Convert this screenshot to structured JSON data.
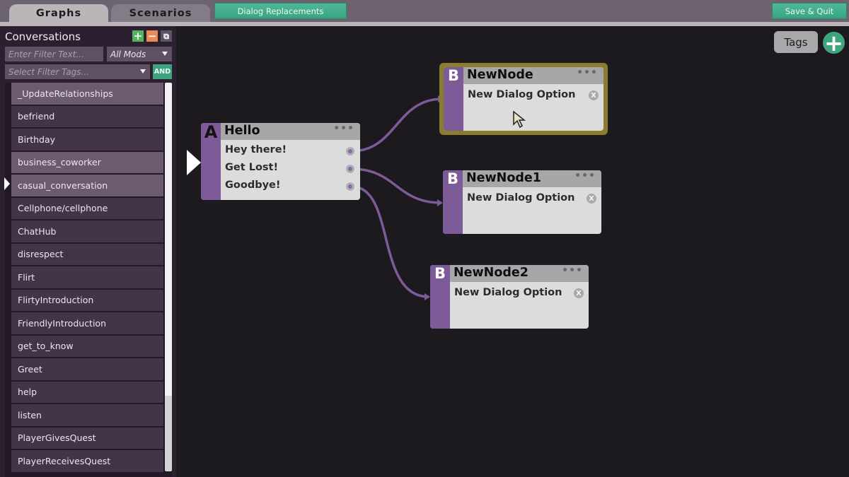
{
  "topbar": {
    "tabs": [
      {
        "label": "Graphs",
        "active": true
      },
      {
        "label": "Scenarios",
        "active": false
      }
    ],
    "dialog_replacements_label": "Dialog Replacements",
    "save_quit_label": "Save & Quit"
  },
  "sidebar": {
    "title": "Conversations",
    "add_icon": "plus-icon",
    "remove_icon": "minus-icon",
    "duplicate_icon": "copy-icon",
    "filter_text_placeholder": "Enter Filter Text...",
    "mods_select_value": "All Mods",
    "filter_tags_placeholder": "Select Filter Tags...",
    "and_label": "AND",
    "selected_index": 4,
    "items": [
      {
        "label": "_UpdateRelationships",
        "highlighted": true
      },
      {
        "label": "befriend",
        "highlighted": false
      },
      {
        "label": "Birthday",
        "highlighted": false
      },
      {
        "label": "business_coworker",
        "highlighted": true
      },
      {
        "label": "casual_conversation",
        "highlighted": true
      },
      {
        "label": "Cellphone/cellphone",
        "highlighted": false
      },
      {
        "label": "ChatHub",
        "highlighted": false
      },
      {
        "label": "disrespect",
        "highlighted": false
      },
      {
        "label": "Flirt",
        "highlighted": false
      },
      {
        "label": "FlirtyIntroduction",
        "highlighted": false
      },
      {
        "label": "FriendlyIntroduction",
        "highlighted": false
      },
      {
        "label": "get_to_know",
        "highlighted": false
      },
      {
        "label": "Greet",
        "highlighted": false
      },
      {
        "label": "help",
        "highlighted": false
      },
      {
        "label": "listen",
        "highlighted": false
      },
      {
        "label": "PlayerGivesQuest",
        "highlighted": false
      },
      {
        "label": "PlayerReceivesQuest",
        "highlighted": false
      }
    ]
  },
  "canvas": {
    "tags_label": "Tags",
    "add_node_icon": "plus-icon",
    "nodes": [
      {
        "id": "A",
        "letter": "A",
        "title": "Hello",
        "menu": "•••",
        "options": [
          "Hey there!",
          "Get Lost!",
          "Goodbye!"
        ],
        "is_entry": true
      },
      {
        "id": "B0",
        "letter": "B",
        "title": "NewNode",
        "menu": "•••",
        "options": [
          "New Dialog Option"
        ],
        "selected": true
      },
      {
        "id": "B1",
        "letter": "B",
        "title": "NewNode1",
        "menu": "•••",
        "options": [
          "New Dialog Option"
        ]
      },
      {
        "id": "B2",
        "letter": "B",
        "title": "NewNode2",
        "menu": "•••",
        "options": [
          "New Dialog Option"
        ]
      }
    ],
    "connections": [
      {
        "from": "A.Hey there!",
        "to": "NewNode"
      },
      {
        "from": "A.Get Lost!",
        "to": "NewNode1"
      },
      {
        "from": "A.Goodbye!",
        "to": "NewNode2"
      }
    ],
    "remove_option_glyph": "X"
  },
  "colors": {
    "accent_green": "#3fa57c",
    "node_purple": "#7d5a98",
    "wire_purple": "#7d5a98",
    "selection_gold": "#8b7c2e"
  }
}
